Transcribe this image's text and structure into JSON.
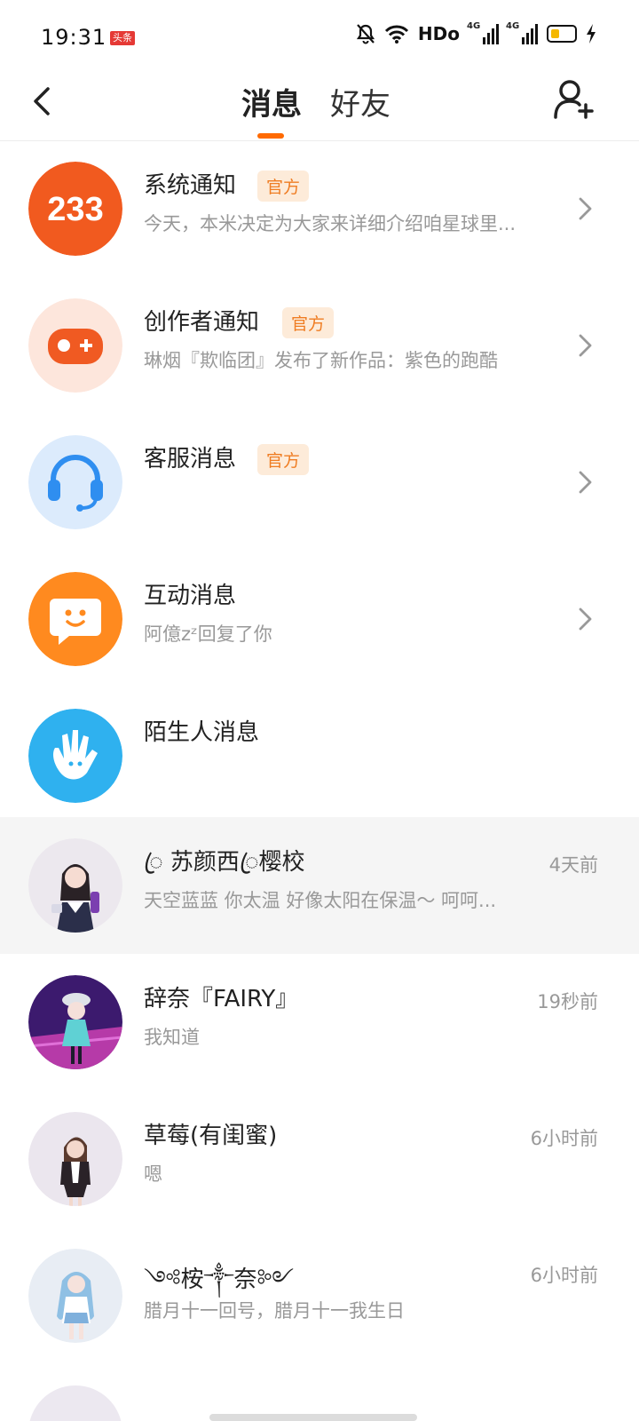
{
  "status_bar": {
    "time": "19:31",
    "badge": "头条",
    "network": "HDo",
    "signal1": "4G",
    "signal2": "4G"
  },
  "header": {
    "tabs": {
      "messages": "消息",
      "friends": "好友"
    }
  },
  "official_label": "官方",
  "system_items": [
    {
      "title": "系统通知",
      "subtitle": "今天，本米决定为大家来详细介绍咱星球里...",
      "icon": "233-logo-icon"
    },
    {
      "title": "创作者通知",
      "subtitle": "琳烟『欺临团』发布了新作品：紫色的跑酷",
      "icon": "gamepad-icon"
    },
    {
      "title": "客服消息",
      "subtitle": "",
      "icon": "headset-icon"
    },
    {
      "title": "互动消息",
      "subtitle": "阿億zᶻ回复了你",
      "icon": "chat-smile-icon"
    },
    {
      "title": "陌生人消息",
      "subtitle": "",
      "icon": "wave-hand-icon"
    }
  ],
  "chats": [
    {
      "name": "ꦿ 苏颜西ꦿ樱校",
      "preview": "天空蓝蓝 你太温 好像太阳在保温～ 呵呵...",
      "time": "4天前"
    },
    {
      "name": "辞奈『FAIRY』",
      "preview": "我知道",
      "time": "19秒前"
    },
    {
      "name": "草莓(有闺蜜)",
      "preview": "嗯",
      "time": "6小时前"
    },
    {
      "name": "༺桉༒奈༻",
      "preview": "腊月十一回号，腊月十一我生日",
      "time": "6小时前"
    }
  ],
  "colors": {
    "accent": "#ff6a00",
    "official": "#ef7d23"
  }
}
